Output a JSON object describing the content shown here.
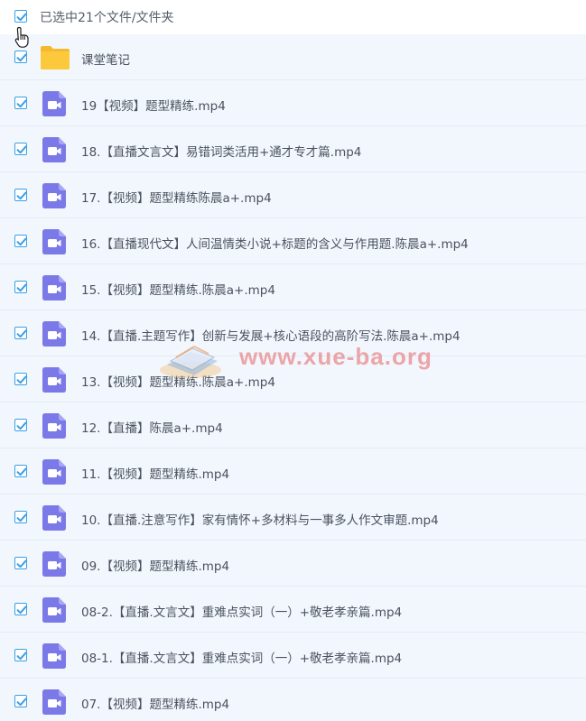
{
  "header": {
    "selected_label": "已选中21个文件/文件夹",
    "select_all_checked": true
  },
  "colors": {
    "accent": "#3aa0e8",
    "row_background": "#f2f7fd",
    "video_icon": "#7b79e8",
    "folder_icon": "#fcc93c",
    "watermark": "#e86262"
  },
  "watermark": {
    "text": "www.xue-ba.org"
  },
  "files": [
    {
      "name": "课堂笔记",
      "type": "folder-icon",
      "checked": true
    },
    {
      "name": "19【视频】题型精练.mp4",
      "type": "video-file-icon",
      "checked": true
    },
    {
      "name": "18.【直播文言文】易错词类活用+通才专才篇.mp4",
      "type": "video-file-icon",
      "checked": true
    },
    {
      "name": "17.【视频】题型精练陈晨a+.mp4",
      "type": "video-file-icon",
      "checked": true
    },
    {
      "name": "16.【直播现代文】人间温情类小说+标题的含义与作用题.陈晨a+.mp4",
      "type": "video-file-icon",
      "checked": true
    },
    {
      "name": "15.【视频】题型精练.陈晨a+.mp4",
      "type": "video-file-icon",
      "checked": true
    },
    {
      "name": "14.【直播.主题写作】创新与发展+核心语段的高阶写法.陈晨a+.mp4",
      "type": "video-file-icon",
      "checked": true
    },
    {
      "name": "13.【视频】题型精练.陈晨a+.mp4",
      "type": "video-file-icon",
      "checked": true
    },
    {
      "name": "12.【直播】陈晨a+.mp4",
      "type": "video-file-icon",
      "checked": true
    },
    {
      "name": "11.【视频】题型精练.mp4",
      "type": "video-file-icon",
      "checked": true
    },
    {
      "name": "10.【直播.注意写作】家有情怀+多材料与一事多人作文审题.mp4",
      "type": "video-file-icon",
      "checked": true
    },
    {
      "name": "09.【视频】题型精练.mp4",
      "type": "video-file-icon",
      "checked": true
    },
    {
      "name": "08-2.【直播.文言文】重难点实词（一）+敬老孝亲篇.mp4",
      "type": "video-file-icon",
      "checked": true
    },
    {
      "name": "08-1.【直播.文言文】重难点实词（一）+敬老孝亲篇.mp4",
      "type": "video-file-icon",
      "checked": true
    },
    {
      "name": "07.【视频】题型精练.mp4",
      "type": "video-file-icon",
      "checked": true
    }
  ]
}
